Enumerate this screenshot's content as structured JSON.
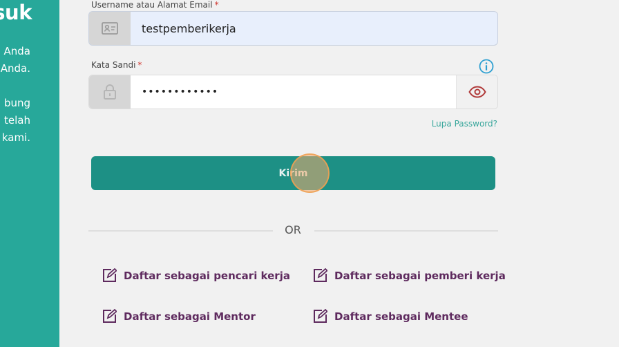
{
  "side_panel": {
    "title": "suk",
    "lines": [
      "Anda",
      "Anda.",
      "bung",
      "telah",
      "kami."
    ]
  },
  "login_form": {
    "username": {
      "label": "Username atau Alamat Email",
      "required_mark": "*",
      "value": "testpemberikerja",
      "icon": "id-card-icon"
    },
    "password": {
      "label": "Kata Sandi",
      "required_mark": "*",
      "masked_value": "••••••••••••",
      "icon": "lock-icon",
      "toggle_icon": "eye-icon",
      "info_icon": "info-icon"
    },
    "forgot_password": "Lupa Password?",
    "submit_label": "Kirim"
  },
  "divider_text": "OR",
  "register_links": [
    "Daftar sebagai pencari kerja",
    "Daftar sebagai pemberi kerja",
    "Daftar sebagai Mentor",
    "Daftar sebagai Mentee"
  ],
  "colors": {
    "panel_teal": "#27a89a",
    "button_teal": "#1d9085",
    "link_teal": "#3aa79c",
    "register_purple": "#5e2a5e",
    "eye_red": "#b03a3a",
    "info_blue": "#2d9fd1"
  }
}
